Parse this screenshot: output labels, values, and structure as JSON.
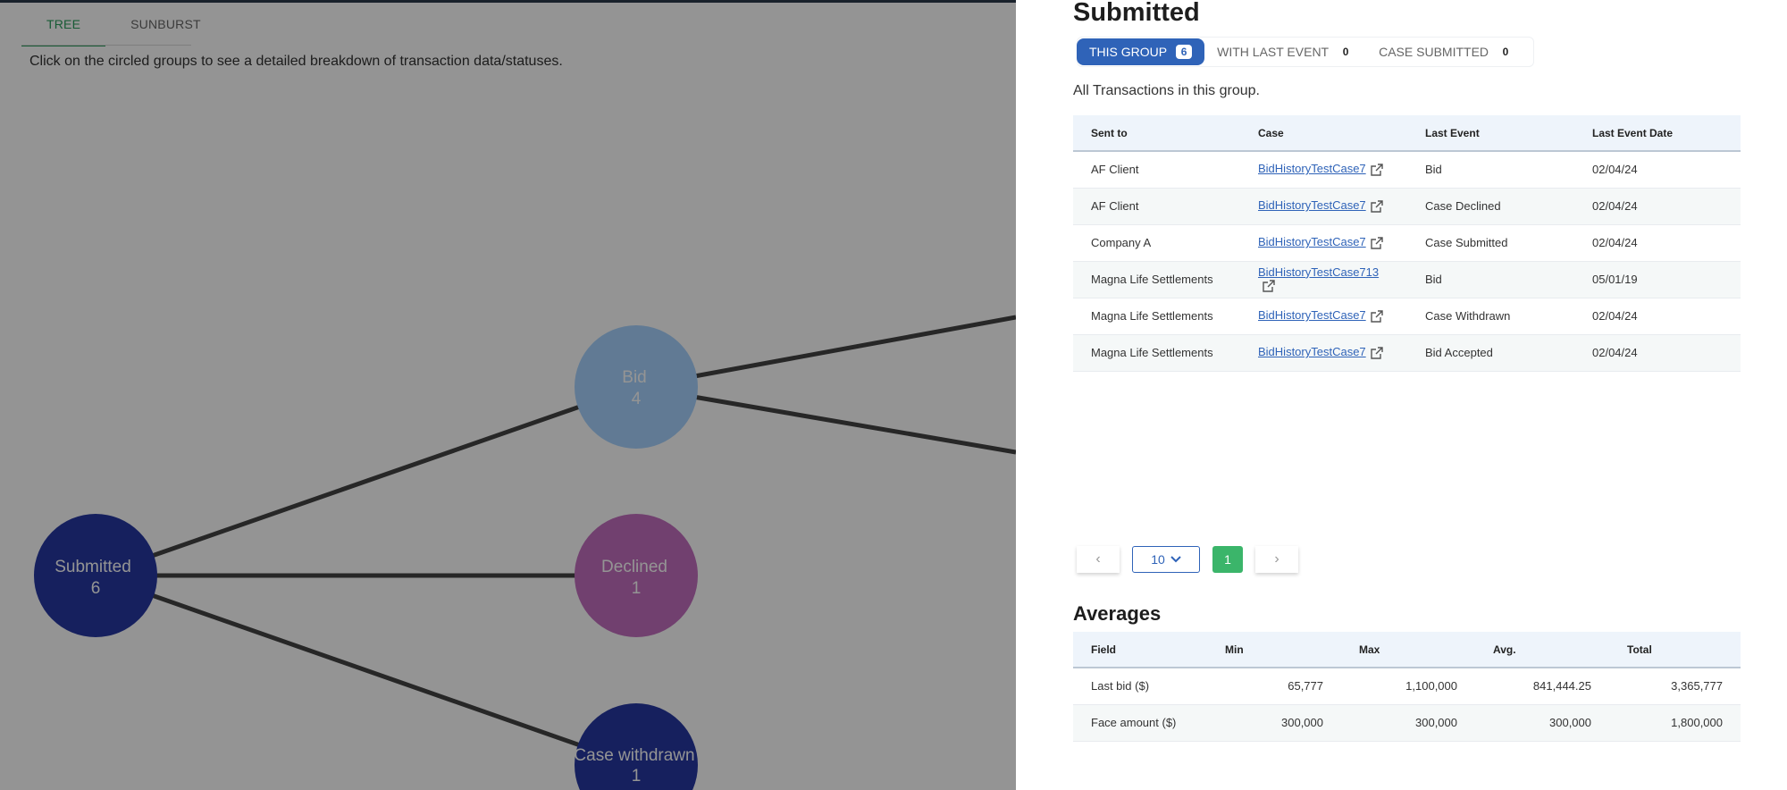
{
  "tabs": [
    {
      "label": "TREE",
      "active": true
    },
    {
      "label": "SUNBURST",
      "active": false
    }
  ],
  "hint": "Click on the circled groups to see a detailed breakdown of transaction data/statuses.",
  "tree": {
    "nodes": [
      {
        "id": "submitted",
        "name": "Submitted",
        "count": "6",
        "color": "#2638a3"
      },
      {
        "id": "bid",
        "name": "Bid",
        "count": "4",
        "color": "#a7d3ff"
      },
      {
        "id": "declined",
        "name": "Declined",
        "count": "1",
        "color": "#c36fbf"
      },
      {
        "id": "withdrawn",
        "name": "Case withdrawn",
        "count": "1",
        "color": "#2638a3"
      }
    ]
  },
  "panel": {
    "title": "Submitted",
    "segments": [
      {
        "label": "THIS GROUP",
        "count": "6"
      },
      {
        "label": "WITH LAST EVENT",
        "count": "0"
      },
      {
        "label": "CASE SUBMITTED",
        "count": "0"
      }
    ],
    "subtitle": "All Transactions in this group.",
    "table": {
      "headers": [
        "Sent to",
        "Case",
        "Last Event",
        "Last Event Date"
      ],
      "rows": [
        {
          "sent_to": "AF Client",
          "case": "BidHistoryTestCase7",
          "event": "Bid",
          "date": "02/04/24"
        },
        {
          "sent_to": "AF Client",
          "case": "BidHistoryTestCase7",
          "event": "Case Declined",
          "date": "02/04/24"
        },
        {
          "sent_to": "Company A",
          "case": "BidHistoryTestCase7",
          "event": "Case Submitted",
          "date": "02/04/24"
        },
        {
          "sent_to": "Magna Life Settlements",
          "case": "BidHistoryTestCase713",
          "event": "Bid",
          "date": "05/01/19"
        },
        {
          "sent_to": "Magna Life Settlements",
          "case": "BidHistoryTestCase7",
          "event": "Case Withdrawn",
          "date": "02/04/24"
        },
        {
          "sent_to": "Magna Life Settlements",
          "case": "BidHistoryTestCase7",
          "event": "Bid Accepted",
          "date": "02/04/24"
        }
      ]
    },
    "pagination": {
      "page_size": "10",
      "current_page": "1"
    },
    "averages": {
      "title": "Averages",
      "headers": [
        "Field",
        "Min",
        "Max",
        "Avg.",
        "Total"
      ],
      "rows": [
        {
          "field": "Last bid ($)",
          "min": "65,777",
          "max": "1,100,000",
          "avg": "841,444.25",
          "total": "3,365,777"
        },
        {
          "field": "Face amount ($)",
          "min": "300,000",
          "max": "300,000",
          "avg": "300,000",
          "total": "1,800,000"
        }
      ]
    }
  }
}
